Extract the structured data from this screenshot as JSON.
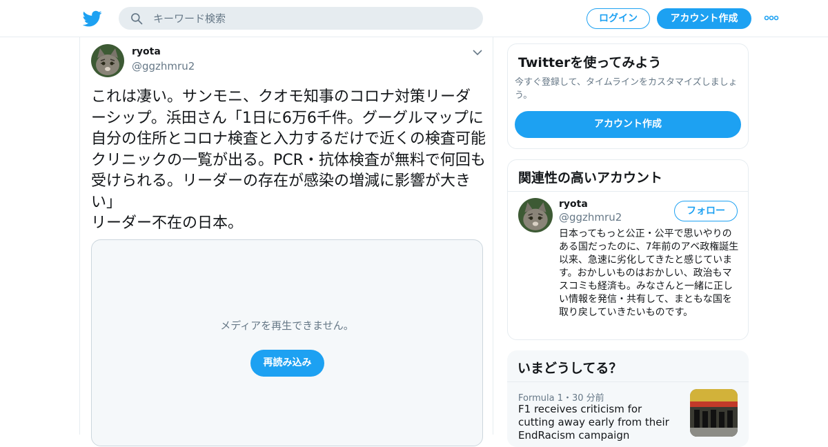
{
  "header": {
    "search_placeholder": "キーワード検索",
    "login_label": "ログイン",
    "signup_label": "アカウント作成"
  },
  "tweet": {
    "author_name": "ryota",
    "author_handle": "@ggzhmru2",
    "text": "これは凄い。サンモニ、クオモ知事のコロナ対策リーダーシップ。浜田さん「1日に6万6千件。グーグルマップに自分の住所とコロナ検査と入力するだけで近くの検査可能クリニックの一覧が出る。PCR・抗体検査が無料で何回も受けられる。リーダーの存在が感染の増減に影響が大きい」\nリーダー不在の日本。",
    "media_message": "メディアを再生できません。",
    "reload_label": "再読み込み"
  },
  "signup_card": {
    "title": "Twitterを使ってみよう",
    "description": "今すぐ登録して、タイムラインをカスタマイズしましょう。",
    "button_label": "アカウント作成"
  },
  "related_card": {
    "title": "関連性の高いアカウント",
    "account_name": "ryota",
    "account_handle": "@ggzhmru2",
    "follow_label": "フォロー",
    "bio": "日本ってもっと公正・公平で思いやりのある国だったのに、7年前のアベ政権誕生以来、急速に劣化してきたと感じています。おかしいものはおかしい、政治もマスコミも経済も。みなさんと一緒に正しい情報を発信・共有して、まともな国を取り戻していきたいものです。"
  },
  "trends_card": {
    "title": "いまどうしてる？",
    "trend_meta": "Formula 1・30 分前",
    "trend_title": "F1 receives criticism for cutting away early from their EndRacism campaign"
  },
  "colors": {
    "accent": "#1da1f2",
    "text": "#14171a",
    "muted": "#657786",
    "border": "#e6ecf0"
  },
  "icons": [
    "twitter-logo-icon",
    "search-icon",
    "more-dots-icon",
    "chevron-down-icon"
  ]
}
